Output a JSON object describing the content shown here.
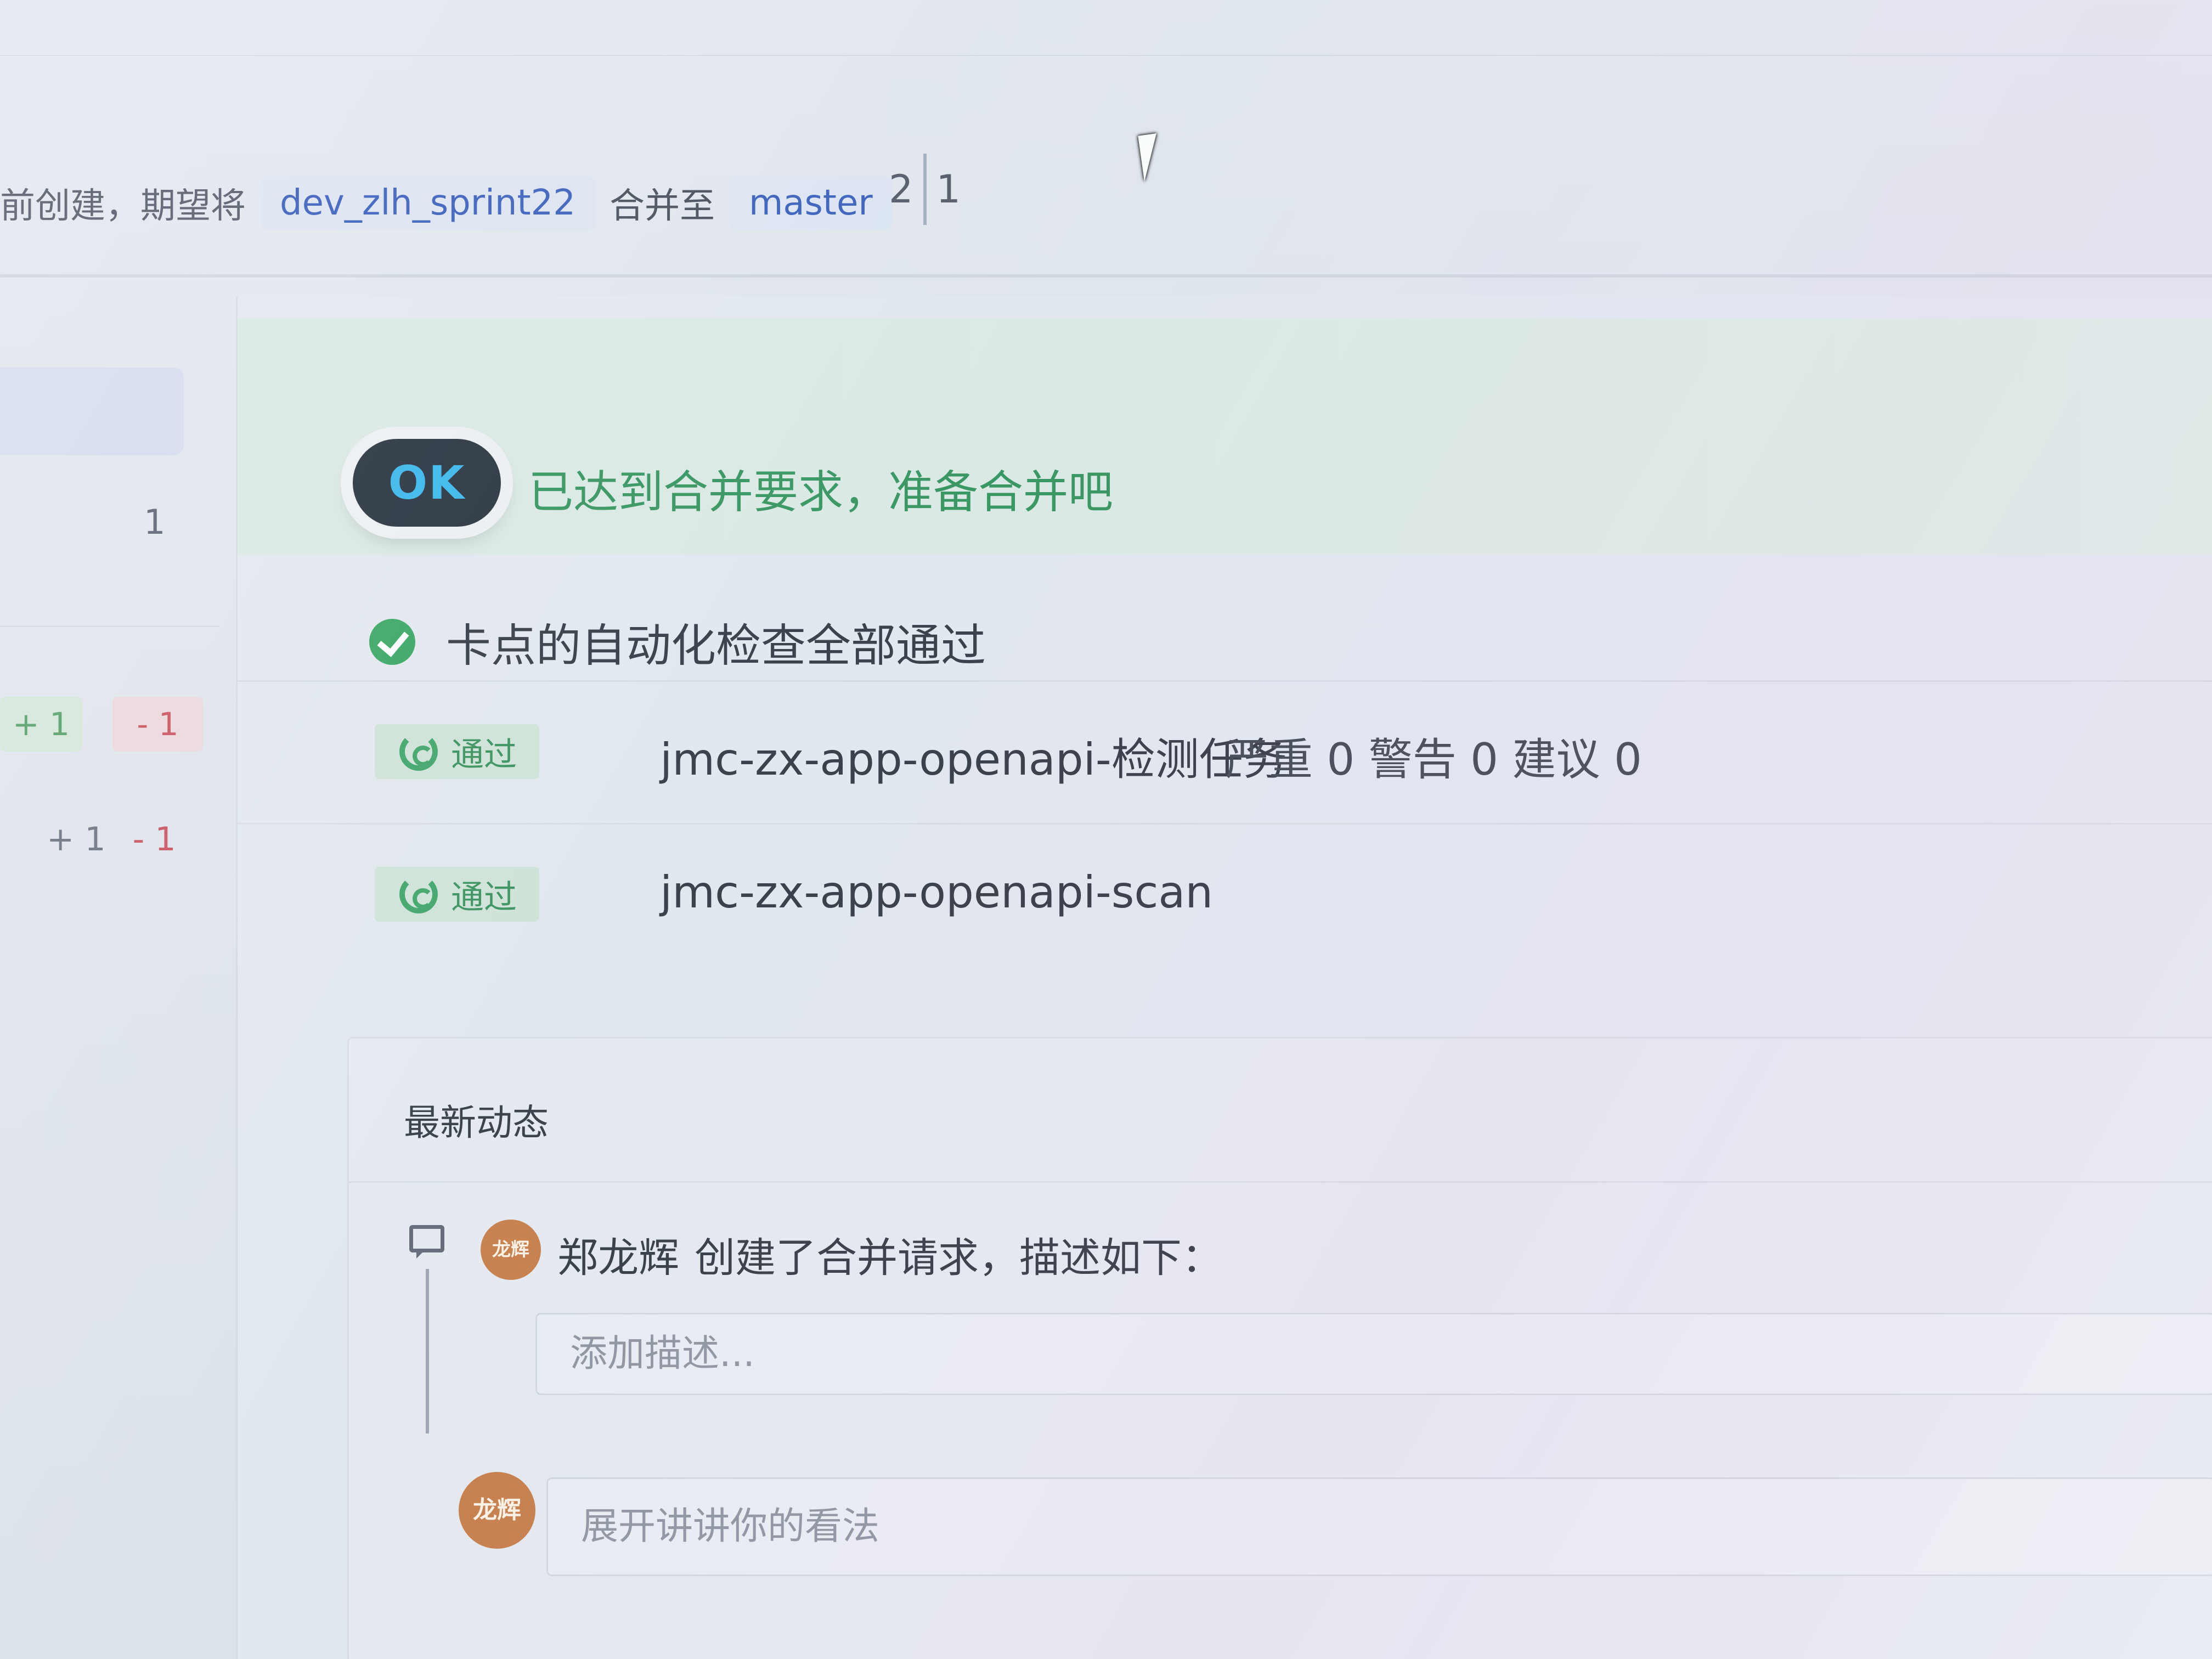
{
  "merge_header": {
    "prefix": "前创建，期望将",
    "source_branch": "dev_zlh_sprint22",
    "merge_to": "合并至",
    "target_branch": "master",
    "counter_left": "2",
    "counter_right": "1"
  },
  "left_column": {
    "number": "1",
    "diff_add": "+ 1",
    "diff_del": "- 1",
    "diff_plain_add": "+ 1",
    "diff_plain_del": "- 1"
  },
  "merge_status": {
    "badge_text": "OK",
    "title": "已达到合并要求，准备合并吧"
  },
  "checks": {
    "summary": "卡点的自动化检查全部通过",
    "tasks": [
      {
        "status": "通过",
        "name": "jmc-zx-app-openapi-检测任务",
        "stats": "严重 0 警告 0 建议 0"
      },
      {
        "status": "通过",
        "name": "jmc-zx-app-openapi-scan"
      }
    ]
  },
  "activity": {
    "title": "最新动态",
    "avatar_text": "龙辉",
    "user": "郑龙辉",
    "action": "创建了合并请求，描述如下：",
    "description_placeholder": "添加描述...",
    "reply_placeholder": "展开讲讲你的看法"
  },
  "colors": {
    "success": "#2fa25a",
    "branch_link": "#2f55b8",
    "delete_red": "#c94a55",
    "avatar": "#c7773f"
  }
}
